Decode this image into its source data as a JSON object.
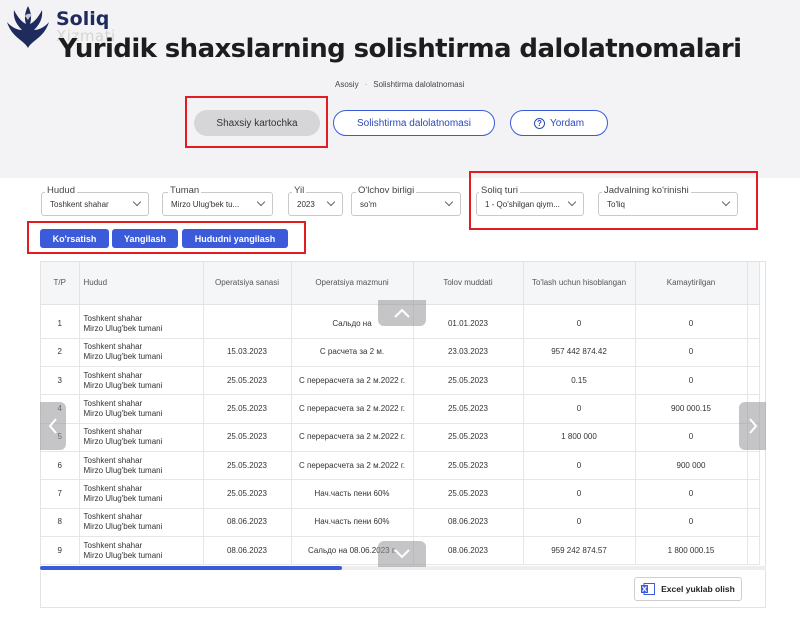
{
  "logo": {
    "line1": "Soliq",
    "line2": "Xizmati"
  },
  "title": "Yuridik shaxslarning solishtirma dalolatnomalari",
  "breadcrumb": {
    "home": "Asosiy",
    "separator": "·",
    "current": "Solishtirma dalolatnomasi"
  },
  "top_buttons": {
    "card": "Shaxsiy kartochka",
    "sol": "Solishtirma dalolatnomasi",
    "help": "Yordam",
    "help_icon_glyph": "?"
  },
  "filters": [
    {
      "label": "Hudud",
      "value": "Toshkent shahar"
    },
    {
      "label": "Tuman",
      "value": "Mirzo Ulug'bek tu..."
    },
    {
      "label": "Yil",
      "value": "2023"
    },
    {
      "label": "O'lchov birligi",
      "value": "so'm"
    },
    {
      "label": "Soliq turi",
      "value": "1 - Qo'shilgan qiym..."
    },
    {
      "label": "Jadvalning ko'rinishi",
      "value": "To'liq"
    }
  ],
  "actions": {
    "show": "Ko'rsatish",
    "refresh": "Yangilash",
    "refresh_region": "Hududni yangilash"
  },
  "table": {
    "headers": [
      "T/P",
      "Hudud",
      "Operatsiya sanasi",
      "Operatsiya mazmuni",
      "Tolov muddati",
      "To'lash uchun hisoblangan",
      "Kamaytirilgan"
    ],
    "rows": [
      {
        "n": "1",
        "h1": "Toshkent shahar",
        "h2": "Mirzo Ulug'bek tumani",
        "date": "",
        "content": "Сальдо на",
        "due": "01.01.2023",
        "calc": "0",
        "red": "0"
      },
      {
        "n": "2",
        "h1": "Toshkent shahar",
        "h2": "Mirzo Ulug'bek tumani",
        "date": "15.03.2023",
        "content": "С расчета за 2 м.",
        "due": "23.03.2023",
        "calc": "957 442 874.42",
        "red": "0"
      },
      {
        "n": "3",
        "h1": "Toshkent shahar",
        "h2": "Mirzo Ulug'bek tumani",
        "date": "25.05.2023",
        "content": "С перерасчета за 2 м.2022 г.",
        "due": "25.05.2023",
        "calc": "0.15",
        "red": "0"
      },
      {
        "n": "4",
        "h1": "Toshkent shahar",
        "h2": "Mirzo Ulug'bek tumani",
        "date": "25.05.2023",
        "content": "С перерасчета за 2 м.2022 г.",
        "due": "25.05.2023",
        "calc": "0",
        "red": "900 000.15"
      },
      {
        "n": "5",
        "h1": "Toshkent shahar",
        "h2": "Mirzo Ulug'bek tumani",
        "date": "25.05.2023",
        "content": "С перерасчета за 2 м.2022 г.",
        "due": "25.05.2023",
        "calc": "1 800 000",
        "red": "0"
      },
      {
        "n": "6",
        "h1": "Toshkent shahar",
        "h2": "Mirzo Ulug'bek tumani",
        "date": "25.05.2023",
        "content": "С перерасчета за 2 м.2022 г.",
        "due": "25.05.2023",
        "calc": "0",
        "red": "900 000"
      },
      {
        "n": "7",
        "h1": "Toshkent shahar",
        "h2": "Mirzo Ulug'bek tumani",
        "date": "25.05.2023",
        "content": "Нач.часть пени 60%",
        "due": "25.05.2023",
        "calc": "0",
        "red": "0"
      },
      {
        "n": "8",
        "h1": "Toshkent shahar",
        "h2": "Mirzo Ulug'bek tumani",
        "date": "08.06.2023",
        "content": "Нач.часть пени 60%",
        "due": "08.06.2023",
        "calc": "0",
        "red": "0"
      },
      {
        "n": "9",
        "h1": "Toshkent shahar",
        "h2": "Mirzo Ulug'bek tumani",
        "date": "08.06.2023",
        "content": "Сальдо на 08.06.2023 г.",
        "due": "08.06.2023",
        "calc": "959 242 874.57",
        "red": "1 800 000.15"
      }
    ]
  },
  "excel_button": "Excel yuklab olish",
  "colors": {
    "accent": "#3b5bdb",
    "highlight": "#e11d23",
    "logo": "#1e2b5c"
  }
}
